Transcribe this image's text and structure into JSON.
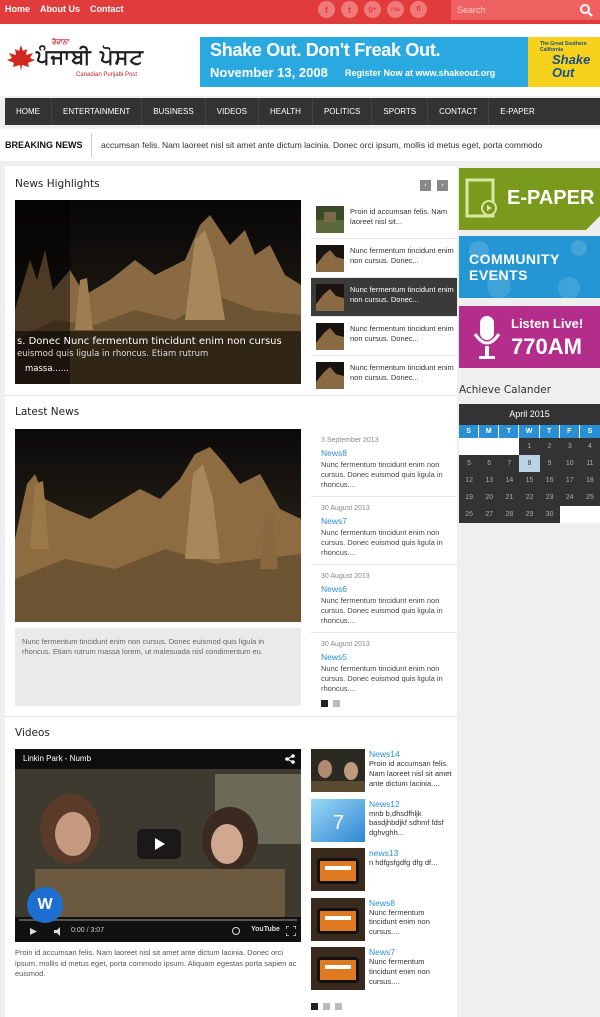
{
  "topbar": {
    "links": [
      "Home",
      "About Us",
      "Contact"
    ],
    "socials": [
      "f",
      "t",
      "g+",
      "rss",
      "fl"
    ],
    "search_placeholder": "Search"
  },
  "header": {
    "logo_small": "ਰੋਜ਼ਾਨਾ",
    "logo_main": "ਪੰਜਾਬੀ ਪੋਸਟ",
    "logo_sub": "Canadian Punjabi Post",
    "banner": {
      "headline": "Shake Out. Don't Freak Out.",
      "date": "November 13, 2008",
      "register": "Register Now at www.shakeout.org",
      "badge_small": "The Great Southern California",
      "badge_big": "Shake Out"
    }
  },
  "nav": [
    "HOME",
    "ENTERTAINMENT",
    "BUSINESS",
    "VIDEOS",
    "HEALTH",
    "POLITICS",
    "SPORTS",
    "CONTACT",
    "E-PAPER"
  ],
  "breaking": {
    "label": "BREAKING NEWS",
    "text": "accumsan felis. Nam laoreet nisl sit amet ante dictum lacinia. Donec orci ipsum, mollis id metus eget, porta commodo"
  },
  "highlights": {
    "title": "News Highlights",
    "prev": "‹",
    "next": "›",
    "caption_line1": "s. Donec     Nunc fermentum tincidunt enim non cursus",
    "caption_line2": "euismod quis ligula in rhoncus. Etiam rutrum",
    "caption_line3": "massa......",
    "items": [
      {
        "text": "Proin id accumsan felis. Nam laoreet nisl sit..."
      },
      {
        "text": "Nunc fermentum tincidunt enim non cursus. Donec..."
      },
      {
        "text": "Nunc fermentum tincidunt enim non cursus. Donec..."
      },
      {
        "text": "Nunc fermentum tincidunt enim non cursus. Donec..."
      },
      {
        "text": "Nunc fermentum tincidunt enim non cursus. Donec..."
      }
    ]
  },
  "latest": {
    "title": "Latest News",
    "caption": "Nunc fermentum tincidunt enim non cursus. Donec euismod quis ligula in rhoncus. Etiam rutrum massa lorem, ut malesuada nisl condimentum eu.",
    "items": [
      {
        "date": "3 September 2013",
        "title": "News8",
        "desc": "Nunc fermentum tincidunt enim non cursus. Donec euismod quis ligula in rhoncus...."
      },
      {
        "date": "30 August 2013",
        "title": "News7",
        "desc": "Nunc fermentum tincidunt enim non cursus. Donec euismod quis ligula in rhoncus...."
      },
      {
        "date": "30 August 2013",
        "title": "News6",
        "desc": "Nunc fermentum tincidunt enim non cursus. Donec euismod quis ligula in rhoncus...."
      },
      {
        "date": "30 August 2013",
        "title": "News5",
        "desc": "Nunc fermentum tincidunt enim non cursus. Donec euismod quis ligula in rhoncus...."
      }
    ]
  },
  "videos": {
    "title": "Videos",
    "player_title": "Linkin Park - Numb",
    "time": "0:00 / 3:07",
    "youtube": "YouTube",
    "description": "Proin id accumsan felis. Nam laoreet nisl sit amet ante dictum lacinia. Donec orci ipsum, mollis id metus eget, porta commodo ipsum. Aliquam egestas porta sapien ac euismod.",
    "items": [
      {
        "title": "News14",
        "desc": "Proin id accumsan felis. Nam laoreet nisl sit amet ante dictum lacinia...."
      },
      {
        "title": "News12",
        "desc": "mnb b,dhsdfhljk basdjhbdjkf sdhmf fdsf dghvghh..."
      },
      {
        "title": "news13",
        "desc": "n hdfgsfgdfg dfg df..."
      },
      {
        "title": "News8",
        "desc": "Nunc fermentum tincidunt enim non cursus...."
      },
      {
        "title": "News7",
        "desc": "Nunc fermentum tincidunt enim non cursus...."
      }
    ]
  },
  "sidebar": {
    "epaper": "E-PAPER",
    "community": "COMMUNITY EVENTS",
    "listen1": "Listen Live!",
    "listen2": "770AM",
    "calendar_title": "Achieve Calander",
    "calendar_month": "April 2015",
    "dow": [
      "S",
      "M",
      "T",
      "W",
      "T",
      "F",
      "S"
    ],
    "today": 8
  },
  "colors": {
    "accent": "#e23b3b",
    "link": "#2a8fd4",
    "nav": "#333333"
  }
}
